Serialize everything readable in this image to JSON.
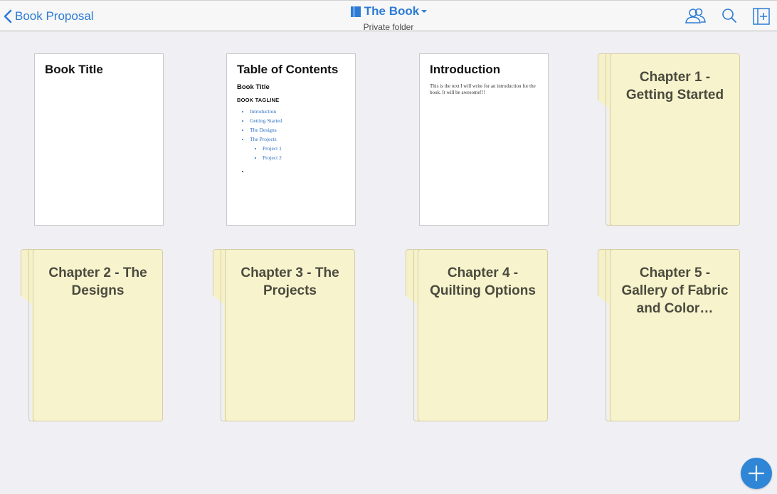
{
  "header": {
    "back_label": "Book Proposal",
    "title": "The Book",
    "subtitle": "Private folder",
    "icons": [
      "collaborate-icon",
      "search-icon",
      "add-section-icon",
      "back-chevron-icon",
      "book-icon",
      "dropdown-caret-icon"
    ]
  },
  "documents": [
    {
      "title": "Book Title"
    },
    {
      "title": "Table of Contents",
      "subheading": "Book Title",
      "tagline": "BOOK TAGLINE",
      "items": [
        "Introduction",
        "Getting Started",
        "The Designs",
        "The Projects"
      ],
      "subitems": [
        "Project 1",
        "Project 2"
      ]
    },
    {
      "title": "Introduction",
      "body": "This is the text I will write for an introduction for the book. It will be awesome!!!"
    }
  ],
  "folders": [
    {
      "title": "Chapter 1 - Getting Started"
    },
    {
      "title": "Chapter 2 - The Designs"
    },
    {
      "title": "Chapter 3 - The Projects"
    },
    {
      "title": "Chapter 4 - Quilting Options"
    },
    {
      "title": "Chapter 5 - Gallery of Fabric and Color…"
    }
  ],
  "colors": {
    "accent": "#2b7bd6",
    "folder": "#f7f3cc",
    "background": "#efeff4"
  }
}
